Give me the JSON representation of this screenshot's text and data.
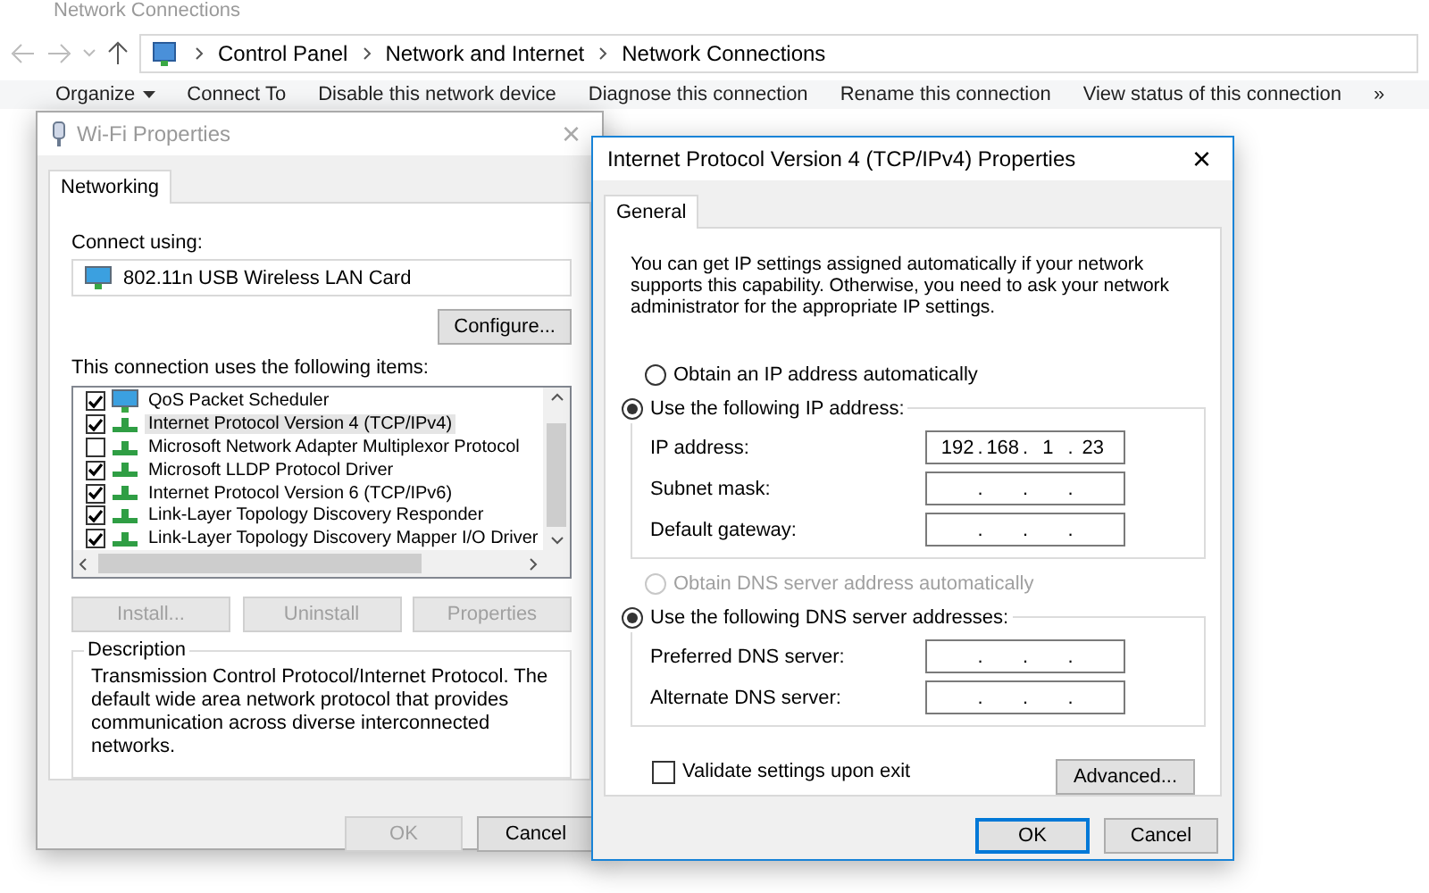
{
  "explorer": {
    "title": "Network Connections",
    "breadcrumb": [
      "Control Panel",
      "Network and Internet",
      "Network Connections"
    ],
    "toolbar": [
      {
        "label": "Organize",
        "dropdown": true
      },
      {
        "label": "Connect To",
        "dropdown": false
      },
      {
        "label": "Disable this network device",
        "dropdown": false
      },
      {
        "label": "Diagnose this connection",
        "dropdown": false
      },
      {
        "label": "Rename this connection",
        "dropdown": false
      },
      {
        "label": "View status of this connection",
        "dropdown": false
      }
    ],
    "more": "»"
  },
  "wifi_dialog": {
    "title": "Wi-Fi Properties",
    "close": "×",
    "tabs": [
      {
        "label": "Networking",
        "selected": true
      }
    ],
    "connect_using_label": "Connect using:",
    "adapter": "802.11n USB Wireless LAN Card",
    "configure_button": "Configure...",
    "items_label": "This connection uses the following items:",
    "items": [
      {
        "label": "QoS Packet Scheduler",
        "checked": true,
        "selected": false,
        "kind": "service"
      },
      {
        "label": "Internet Protocol Version 4 (TCP/IPv4)",
        "checked": true,
        "selected": true,
        "kind": "protocol"
      },
      {
        "label": "Microsoft Network Adapter Multiplexor Protocol",
        "checked": false,
        "selected": false,
        "kind": "protocol"
      },
      {
        "label": "Microsoft LLDP Protocol Driver",
        "checked": true,
        "selected": false,
        "kind": "protocol"
      },
      {
        "label": "Internet Protocol Version 6 (TCP/IPv6)",
        "checked": true,
        "selected": false,
        "kind": "protocol"
      },
      {
        "label": "Link-Layer Topology Discovery Responder",
        "checked": true,
        "selected": false,
        "kind": "protocol"
      },
      {
        "label": "Link-Layer Topology Discovery Mapper I/O Driver",
        "checked": true,
        "selected": false,
        "kind": "protocol"
      }
    ],
    "item_buttons": [
      {
        "label": "Install...",
        "disabled": true
      },
      {
        "label": "Uninstall",
        "disabled": true
      },
      {
        "label": "Properties",
        "disabled": true
      }
    ],
    "description_title": "Description",
    "description": "Transmission Control Protocol/Internet Protocol. The default wide area network protocol that provides communication across diverse interconnected networks.",
    "buttons": [
      {
        "label": "OK",
        "disabled": true
      },
      {
        "label": "Cancel",
        "disabled": false
      }
    ]
  },
  "ipv4_dialog": {
    "title": "Internet Protocol Version 4 (TCP/IPv4) Properties",
    "close": "×",
    "tabs": [
      {
        "label": "General",
        "selected": true
      }
    ],
    "intro": "You can get IP settings assigned automatically if your network supports this capability. Otherwise, you need to ask your network administrator for the appropriate IP settings.",
    "ip_options": [
      {
        "label": "Obtain an IP address automatically",
        "selected": false,
        "disabled": false
      },
      {
        "label": "Use the following IP address:",
        "selected": true,
        "disabled": false
      }
    ],
    "ip_fields": [
      {
        "label": "IP address:",
        "separator": ".",
        "octets": [
          "192",
          "168",
          "1",
          "23"
        ]
      },
      {
        "label": "Subnet mask:",
        "separator": "."
      },
      {
        "label": "Default gateway:",
        "separator": "."
      }
    ],
    "dns_options": [
      {
        "label": "Obtain DNS server address automatically",
        "selected": false,
        "disabled": true
      },
      {
        "label": "Use the following DNS server addresses:",
        "selected": true,
        "disabled": false
      }
    ],
    "dns_fields": [
      {
        "label": "Preferred DNS server:",
        "separator": "."
      },
      {
        "label": "Alternate DNS server:",
        "separator": "."
      }
    ],
    "validate": {
      "label": "Validate settings upon exit",
      "checked": false
    },
    "advanced_button": "Advanced...",
    "buttons": [
      {
        "label": "OK",
        "default": true
      },
      {
        "label": "Cancel",
        "default": false
      }
    ]
  }
}
